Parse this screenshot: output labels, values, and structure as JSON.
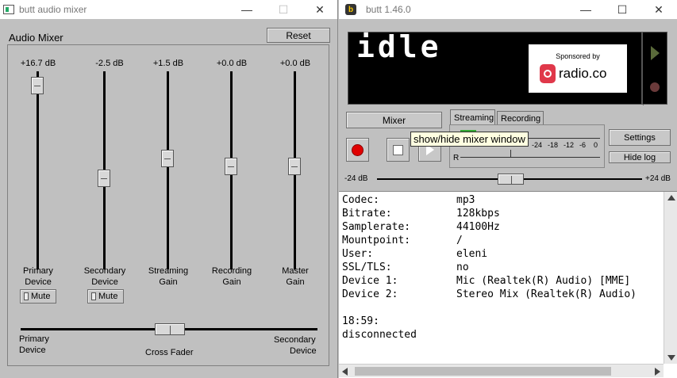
{
  "mixer": {
    "window_title": "butt audio mixer",
    "heading": "Audio Mixer",
    "reset_label": "Reset",
    "channels": [
      {
        "db": "+16.7 dB",
        "label1": "Primary",
        "label2": "Device",
        "mute": "Mute"
      },
      {
        "db": "-2.5 dB",
        "label1": "Secondary",
        "label2": "Device",
        "mute": "Mute"
      },
      {
        "db": "+1.5 dB",
        "label1": "Streaming",
        "label2": "Gain"
      },
      {
        "db": "+0.0 dB",
        "label1": "Recording",
        "label2": "Gain"
      },
      {
        "db": "+0.0 dB",
        "label1": "Master",
        "label2": "Gain"
      }
    ],
    "crossfader": {
      "left1": "Primary",
      "left2": "Device",
      "center": "Cross Fader",
      "right1": "Secondary",
      "right2": "Device"
    }
  },
  "butt": {
    "window_title": "butt 1.46.0",
    "lcd_text": "idle",
    "sponsor_text": "Sponsored by",
    "sponsor_brand": "radio.co",
    "mixer_button": "Mixer",
    "tabs": [
      "Streaming",
      "Recording"
    ],
    "tooltip": "show/hide mixer window",
    "meter_ticks": [
      "-24",
      "-18",
      "-12",
      "-6",
      "0"
    ],
    "meter_channel": "R",
    "settings_button": "Settings",
    "hidelog_button": "Hide log",
    "gain_left": "-24 dB",
    "gain_right": "+24 dB",
    "log": [
      {
        "k": "Codec:",
        "v": "mp3"
      },
      {
        "k": "Bitrate:",
        "v": "128kbps"
      },
      {
        "k": "Samplerate:",
        "v": "44100Hz"
      },
      {
        "k": "Mountpoint:",
        "v": "/"
      },
      {
        "k": "User:",
        "v": "eleni"
      },
      {
        "k": "SSL/TLS:",
        "v": "no"
      },
      {
        "k": "Device 1:",
        "v": "Mic (Realtek(R) Audio) [MME]"
      },
      {
        "k": "Device 2:",
        "v": "Stereo Mix (Realtek(R) Audio)"
      }
    ],
    "log_time": "18:59:",
    "log_status": "disconnected"
  },
  "colors": {
    "record": "#e00000",
    "lcd_bg": "#000000",
    "tooltip_bg": "#ffffe1"
  },
  "icons": [
    "app-icon",
    "minimize-icon",
    "maximize-icon",
    "close-icon",
    "record-icon",
    "stop-icon",
    "play-icon",
    "radio-co-logo-icon"
  ]
}
